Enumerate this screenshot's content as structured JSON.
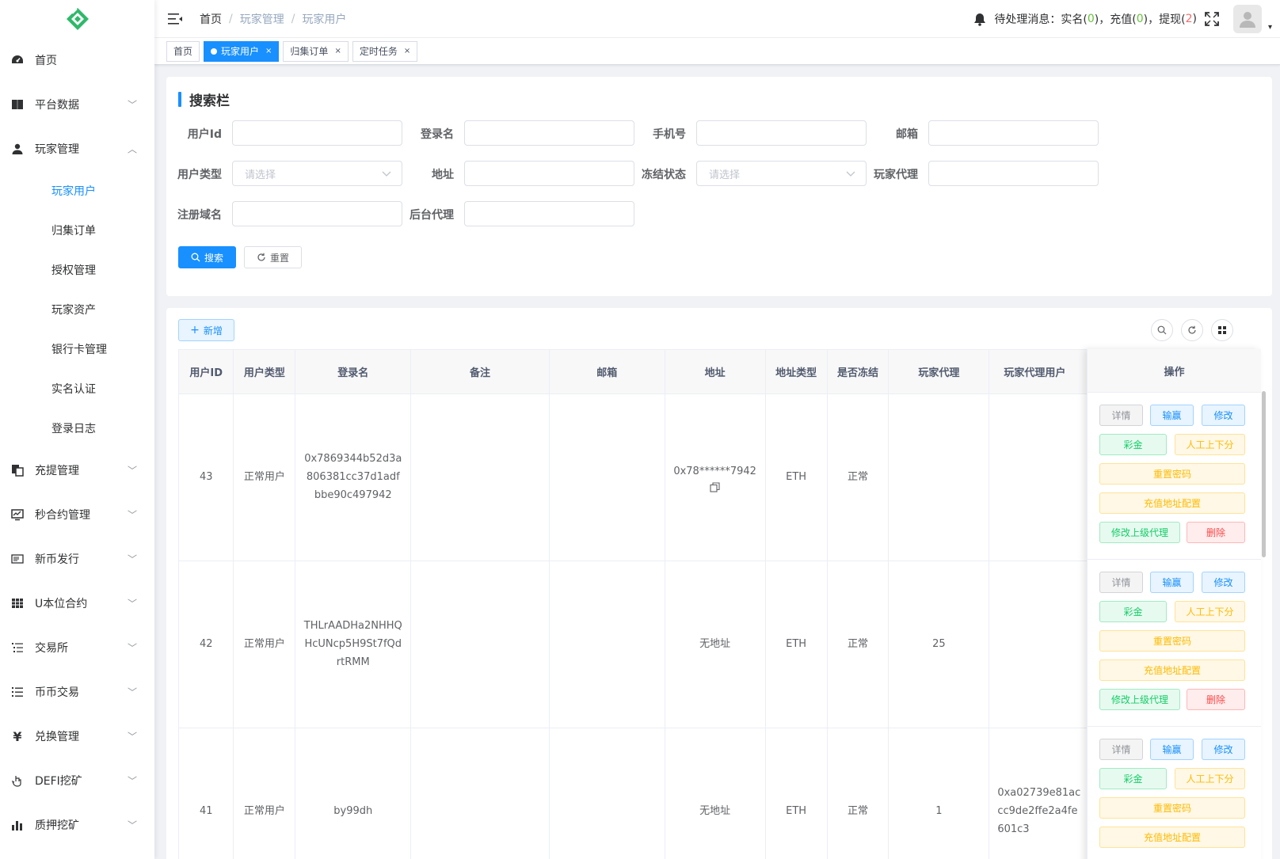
{
  "sidebar": {
    "items": [
      {
        "label": "首页",
        "icon": "dashboard-icon",
        "arrow": ""
      },
      {
        "label": "平台数据",
        "icon": "book-icon",
        "arrow": "﹀"
      },
      {
        "label": "玩家管理",
        "icon": "user-icon",
        "arrow": "︿"
      }
    ],
    "sub_items": [
      "玩家用户",
      "归集订单",
      "授权管理",
      "玩家资产",
      "银行卡管理",
      "实名认证",
      "登录日志"
    ],
    "items_after": [
      {
        "label": "充提管理",
        "icon": "copy-icon"
      },
      {
        "label": "秒合约管理",
        "icon": "monitor-icon"
      },
      {
        "label": "新币发行",
        "icon": "ticket-icon"
      },
      {
        "label": "U本位合约",
        "icon": "table-icon"
      },
      {
        "label": "交易所",
        "icon": "list-icon"
      },
      {
        "label": "币币交易",
        "icon": "list2-icon"
      },
      {
        "label": "兑换管理",
        "icon": "yen-icon"
      },
      {
        "label": "DEFI挖矿",
        "icon": "hand-icon"
      },
      {
        "label": "质押挖矿",
        "icon": "chart-icon"
      }
    ],
    "expand_arrow": "﹀"
  },
  "header": {
    "breadcrumb": [
      "首页",
      "玩家管理",
      "玩家用户"
    ],
    "sep": "/",
    "notice_prefix": "待处理消息：实名(",
    "notice_realname": " 0 ",
    "notice_mid1": ")，充值(",
    "notice_recharge": " 0 ",
    "notice_mid2": ")，提现(",
    "notice_withdraw": " 2 ",
    "notice_suffix": ")",
    "caret": "▾"
  },
  "tags": [
    {
      "label": "首页",
      "close": ""
    },
    {
      "label": "玩家用户",
      "close": "×"
    },
    {
      "label": "归集订单",
      "close": "×"
    },
    {
      "label": "定时任务",
      "close": "×"
    }
  ],
  "search": {
    "title": "搜索栏",
    "labels": {
      "user_id": "用户Id",
      "login_name": "登录名",
      "phone": "手机号",
      "email": "邮箱",
      "user_type": "用户类型",
      "address": "地址",
      "freeze_status": "冻结状态",
      "player_agent": "玩家代理",
      "reg_domain": "注册域名",
      "backend_agent": "后台代理"
    },
    "select_placeholder": "请选择",
    "search_button": "搜索",
    "reset_button": "重置"
  },
  "table": {
    "add_button": "新增",
    "columns": [
      "用户ID",
      "用户类型",
      "登录名",
      "备注",
      "邮箱",
      "地址",
      "地址类型",
      "是否冻结",
      "玩家代理",
      "玩家代理用户"
    ],
    "ops_header": "操作",
    "rows": [
      {
        "id": "43",
        "type": "正常用户",
        "login": "0x7869344b52d3a806381cc37d1adfbbe90c497942",
        "remark": "",
        "email": "",
        "address": "0x78******7942",
        "addr_type": "ETH",
        "frozen": "正常",
        "agent": "",
        "agent_user": ""
      },
      {
        "id": "42",
        "type": "正常用户",
        "login": "THLrAADHa2NHHQHcUNcp5H9St7fQdrtRMM",
        "remark": "",
        "email": "",
        "address": "无地址",
        "addr_type": "ETH",
        "frozen": "正常",
        "agent": "25",
        "agent_user": ""
      },
      {
        "id": "41",
        "type": "正常用户",
        "login": "by99dh",
        "remark": "",
        "email": "",
        "address": "无地址",
        "addr_type": "ETH",
        "frozen": "正常",
        "agent": "1",
        "agent_user": "0xa02739e81accc9de2ffe2a4fe601c3"
      }
    ],
    "ops": {
      "detail": "详情",
      "win_lose": "输赢",
      "edit": "修改",
      "bonus": "彩金",
      "manual": "人工上下分",
      "reset_pwd": "重置密码",
      "deposit_addr": "充值地址配置",
      "edit_parent": "修改上级代理",
      "delete": "删除"
    }
  },
  "colors": {
    "primary": "#1890ff",
    "success": "#13ce66",
    "warning": "#ffba00",
    "danger": "#ff4949",
    "info": "#909399"
  }
}
